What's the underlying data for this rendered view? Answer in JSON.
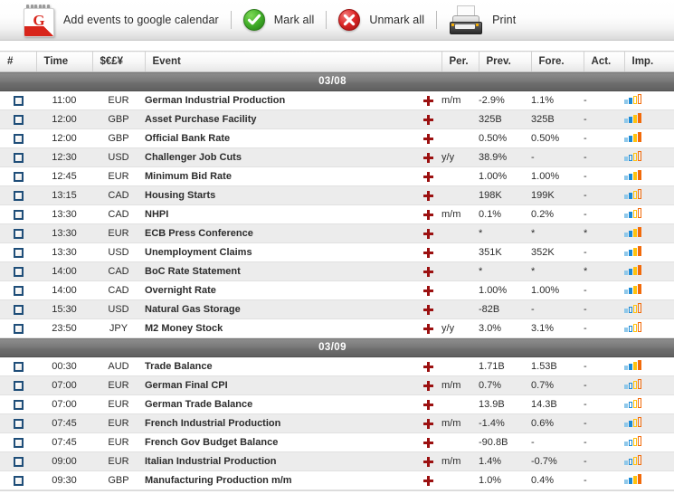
{
  "toolbar": {
    "google_calendar_label": "Add events to google calendar",
    "google_calendar_icon": "google-calendar-icon",
    "google_calendar_letter": "G",
    "mark_all_label": "Mark all",
    "mark_all_icon": "green-check-circle-icon",
    "unmark_all_label": "Unmark all",
    "unmark_all_icon": "red-x-circle-icon",
    "print_label": "Print",
    "print_icon": "printer-icon"
  },
  "table": {
    "headers": {
      "num": "#",
      "time": "Time",
      "currency": "$€£¥",
      "event": "Event",
      "per": "Per.",
      "prev": "Prev.",
      "fore": "Fore.",
      "act": "Act.",
      "imp": "Imp."
    },
    "colors": {
      "accent_red": "#9c1111",
      "checkbox_border": "#1f4e79",
      "band_gray": "#6d6d6d",
      "impact_1": "#8fc8ea",
      "impact_2": "#1b8ad6",
      "impact_3": "#ffc20e",
      "impact_4": "#f26a0a",
      "alt_row": "#ececec"
    },
    "groups": [
      {
        "date": "03/08",
        "rows": [
          {
            "time": "11:00",
            "cur": "EUR",
            "event": "German Industrial Production",
            "per": "m/m",
            "prev": "-2.9%",
            "fore": "1.1%",
            "act": "-",
            "imp": 2
          },
          {
            "time": "12:00",
            "cur": "GBP",
            "event": "Asset Purchase Facility",
            "per": "",
            "prev": "325B",
            "fore": "325B",
            "act": "-",
            "imp": 4
          },
          {
            "time": "12:00",
            "cur": "GBP",
            "event": "Official Bank Rate",
            "per": "",
            "prev": "0.50%",
            "fore": "0.50%",
            "act": "-",
            "imp": 4
          },
          {
            "time": "12:30",
            "cur": "USD",
            "event": "Challenger Job Cuts",
            "per": "y/y",
            "prev": "38.9%",
            "fore": "-",
            "act": "-",
            "imp": 1
          },
          {
            "time": "12:45",
            "cur": "EUR",
            "event": "Minimum Bid Rate",
            "per": "",
            "prev": "1.00%",
            "fore": "1.00%",
            "act": "-",
            "imp": 4
          },
          {
            "time": "13:15",
            "cur": "CAD",
            "event": "Housing Starts",
            "per": "",
            "prev": "198K",
            "fore": "199K",
            "act": "-",
            "imp": 2
          },
          {
            "time": "13:30",
            "cur": "CAD",
            "event": "NHPI",
            "per": "m/m",
            "prev": "0.1%",
            "fore": "0.2%",
            "act": "-",
            "imp": 2
          },
          {
            "time": "13:30",
            "cur": "EUR",
            "event": "ECB Press Conference",
            "per": "",
            "prev": "*",
            "fore": "*",
            "act": "*",
            "imp": 4
          },
          {
            "time": "13:30",
            "cur": "USD",
            "event": "Unemployment Claims",
            "per": "",
            "prev": "351K",
            "fore": "352K",
            "act": "-",
            "imp": 4
          },
          {
            "time": "14:00",
            "cur": "CAD",
            "event": "BoC Rate Statement",
            "per": "",
            "prev": "*",
            "fore": "*",
            "act": "*",
            "imp": 4
          },
          {
            "time": "14:00",
            "cur": "CAD",
            "event": "Overnight Rate",
            "per": "",
            "prev": "1.00%",
            "fore": "1.00%",
            "act": "-",
            "imp": 4
          },
          {
            "time": "15:30",
            "cur": "USD",
            "event": "Natural Gas Storage",
            "per": "",
            "prev": "-82B",
            "fore": "-",
            "act": "-",
            "imp": 1
          },
          {
            "time": "23:50",
            "cur": "JPY",
            "event": "M2 Money Stock",
            "per": "y/y",
            "prev": "3.0%",
            "fore": "3.1%",
            "act": "-",
            "imp": 1
          }
        ]
      },
      {
        "date": "03/09",
        "rows": [
          {
            "time": "00:30",
            "cur": "AUD",
            "event": "Trade Balance",
            "per": "",
            "prev": "1.71B",
            "fore": "1.53B",
            "act": "-",
            "imp": 4
          },
          {
            "time": "07:00",
            "cur": "EUR",
            "event": "German Final CPI",
            "per": "m/m",
            "prev": "0.7%",
            "fore": "0.7%",
            "act": "-",
            "imp": 1
          },
          {
            "time": "07:00",
            "cur": "EUR",
            "event": "German Trade Balance",
            "per": "",
            "prev": "13.9B",
            "fore": "14.3B",
            "act": "-",
            "imp": 1
          },
          {
            "time": "07:45",
            "cur": "EUR",
            "event": "French Industrial Production",
            "per": "m/m",
            "prev": "-1.4%",
            "fore": "0.6%",
            "act": "-",
            "imp": 2
          },
          {
            "time": "07:45",
            "cur": "EUR",
            "event": "French Gov Budget Balance",
            "per": "",
            "prev": "-90.8B",
            "fore": "-",
            "act": "-",
            "imp": 1
          },
          {
            "time": "09:00",
            "cur": "EUR",
            "event": "Italian Industrial Production",
            "per": "m/m",
            "prev": "1.4%",
            "fore": "-0.7%",
            "act": "-",
            "imp": 1
          },
          {
            "time": "09:30",
            "cur": "GBP",
            "event": "Manufacturing Production m/m",
            "per": "",
            "prev": "1.0%",
            "fore": "0.4%",
            "act": "-",
            "imp": 4
          }
        ]
      }
    ]
  }
}
